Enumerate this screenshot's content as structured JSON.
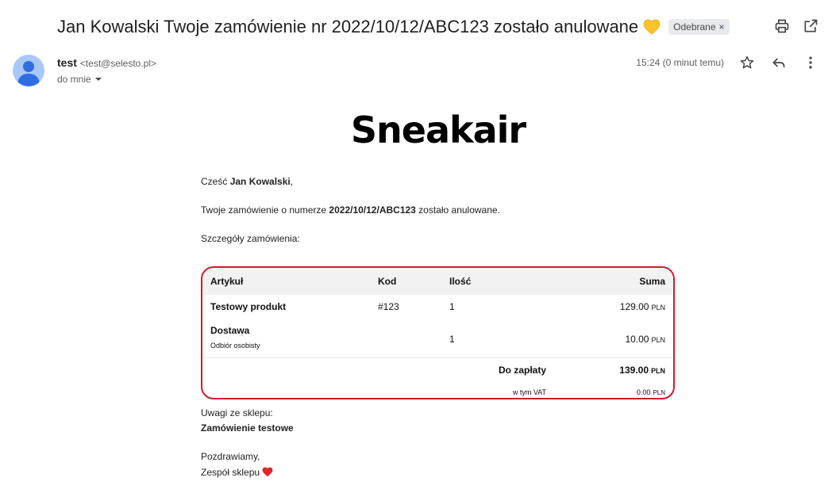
{
  "email": {
    "subject": "Jan Kowalski Twoje zamówienie nr 2022/10/12/ABC123 zostało anulowane",
    "label": "Odebrane",
    "label_close": "×",
    "sender_name": "test",
    "sender_address": "<test@selesto.pl>",
    "recipient": "do mnie",
    "time": "15:24 (0 minut temu)"
  },
  "icons": {
    "subject_emoji": "yellow-heart-icon",
    "print": "print-icon",
    "open_new": "open-in-new-window-icon",
    "star": "star-icon",
    "reply": "reply-icon",
    "more": "more-vert-icon",
    "avatar": "person-avatar-icon",
    "heart_red": "red-heart-icon"
  },
  "colors": {
    "table_border": "#d8182a",
    "header_bg": "#f2f2f2",
    "avatar_bg": "#a8c7fa",
    "avatar_fg": "#2f6ee0",
    "heart_yellow": "#f8c429",
    "heart_red": "#e0242e"
  },
  "message": {
    "logo": "Sneakair",
    "greeting_prefix": "Cześć ",
    "greeting_name": "Jan Kowalski",
    "greeting_suffix": ",",
    "info_prefix": "Twoje zamówienie o numerze ",
    "order_number": "2022/10/12/ABC123",
    "info_suffix": " zostało anulowane.",
    "details_label": "Szczegóły zamówienia:",
    "table": {
      "headers": {
        "item": "Artykuł",
        "code": "Kod",
        "qty": "Ilość",
        "sum": "Suma"
      },
      "rows": [
        {
          "name": "Testowy produkt",
          "sub": "",
          "code": "#123",
          "qty": "1",
          "amount": "129.00",
          "currency": "PLN"
        },
        {
          "name": "Dostawa",
          "sub": "Odbiór osobisty",
          "code": "",
          "qty": "1",
          "amount": "10.00",
          "currency": "PLN"
        }
      ],
      "total_label": "Do zapłaty",
      "total_amount": "139.00",
      "total_currency": "PLN",
      "vat_label": "w tym VAT",
      "vat_amount": "0.00",
      "vat_currency": "PLN"
    },
    "shop_notes_label": "Uwagi ze sklepu:",
    "shop_notes": "Zamówienie testowe",
    "closing": "Pozdrawiamy,",
    "signature": "Zespół sklepu"
  }
}
